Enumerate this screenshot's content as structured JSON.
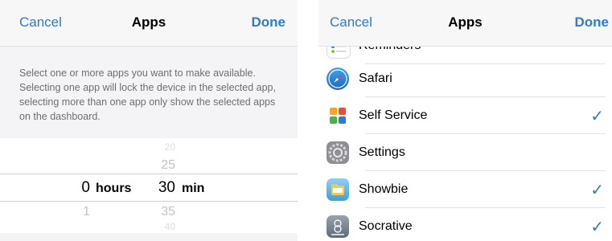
{
  "left_screen": {
    "nav": {
      "cancel_label": "Cancel",
      "title": "Apps",
      "done_label": "Done"
    },
    "description": "Select one or more apps you want to make available. Selecting one app will lock the device in the selected app, selecting more than one app only show the selected apps on the dashboard.",
    "picker": {
      "hours": {
        "above": "",
        "selected": "0",
        "below": "1",
        "unit": "hours"
      },
      "minutes": {
        "above_far": "20",
        "above": "25",
        "selected": "30",
        "below": "35",
        "below_far": "40",
        "unit": "min"
      }
    }
  },
  "right_screen": {
    "nav": {
      "cancel_label": "Cancel",
      "title": "Apps",
      "done_label": "Done"
    },
    "apps": [
      {
        "name": "Reminders",
        "icon": "reminders-icon",
        "checked": false,
        "check": ""
      },
      {
        "name": "Safari",
        "icon": "safari-icon",
        "checked": false,
        "check": ""
      },
      {
        "name": "Self Service",
        "icon": "self-service-icon",
        "checked": true,
        "check": "✓"
      },
      {
        "name": "Settings",
        "icon": "settings-icon",
        "checked": false,
        "check": ""
      },
      {
        "name": "Showbie",
        "icon": "showbie-icon",
        "checked": true,
        "check": "✓"
      },
      {
        "name": "Socrative",
        "icon": "socrative-icon",
        "checked": true,
        "check": "✓"
      }
    ]
  },
  "colors": {
    "accent": "#2f7ad2",
    "background": "#f4f4f6",
    "separator": "#e4e4e7"
  }
}
